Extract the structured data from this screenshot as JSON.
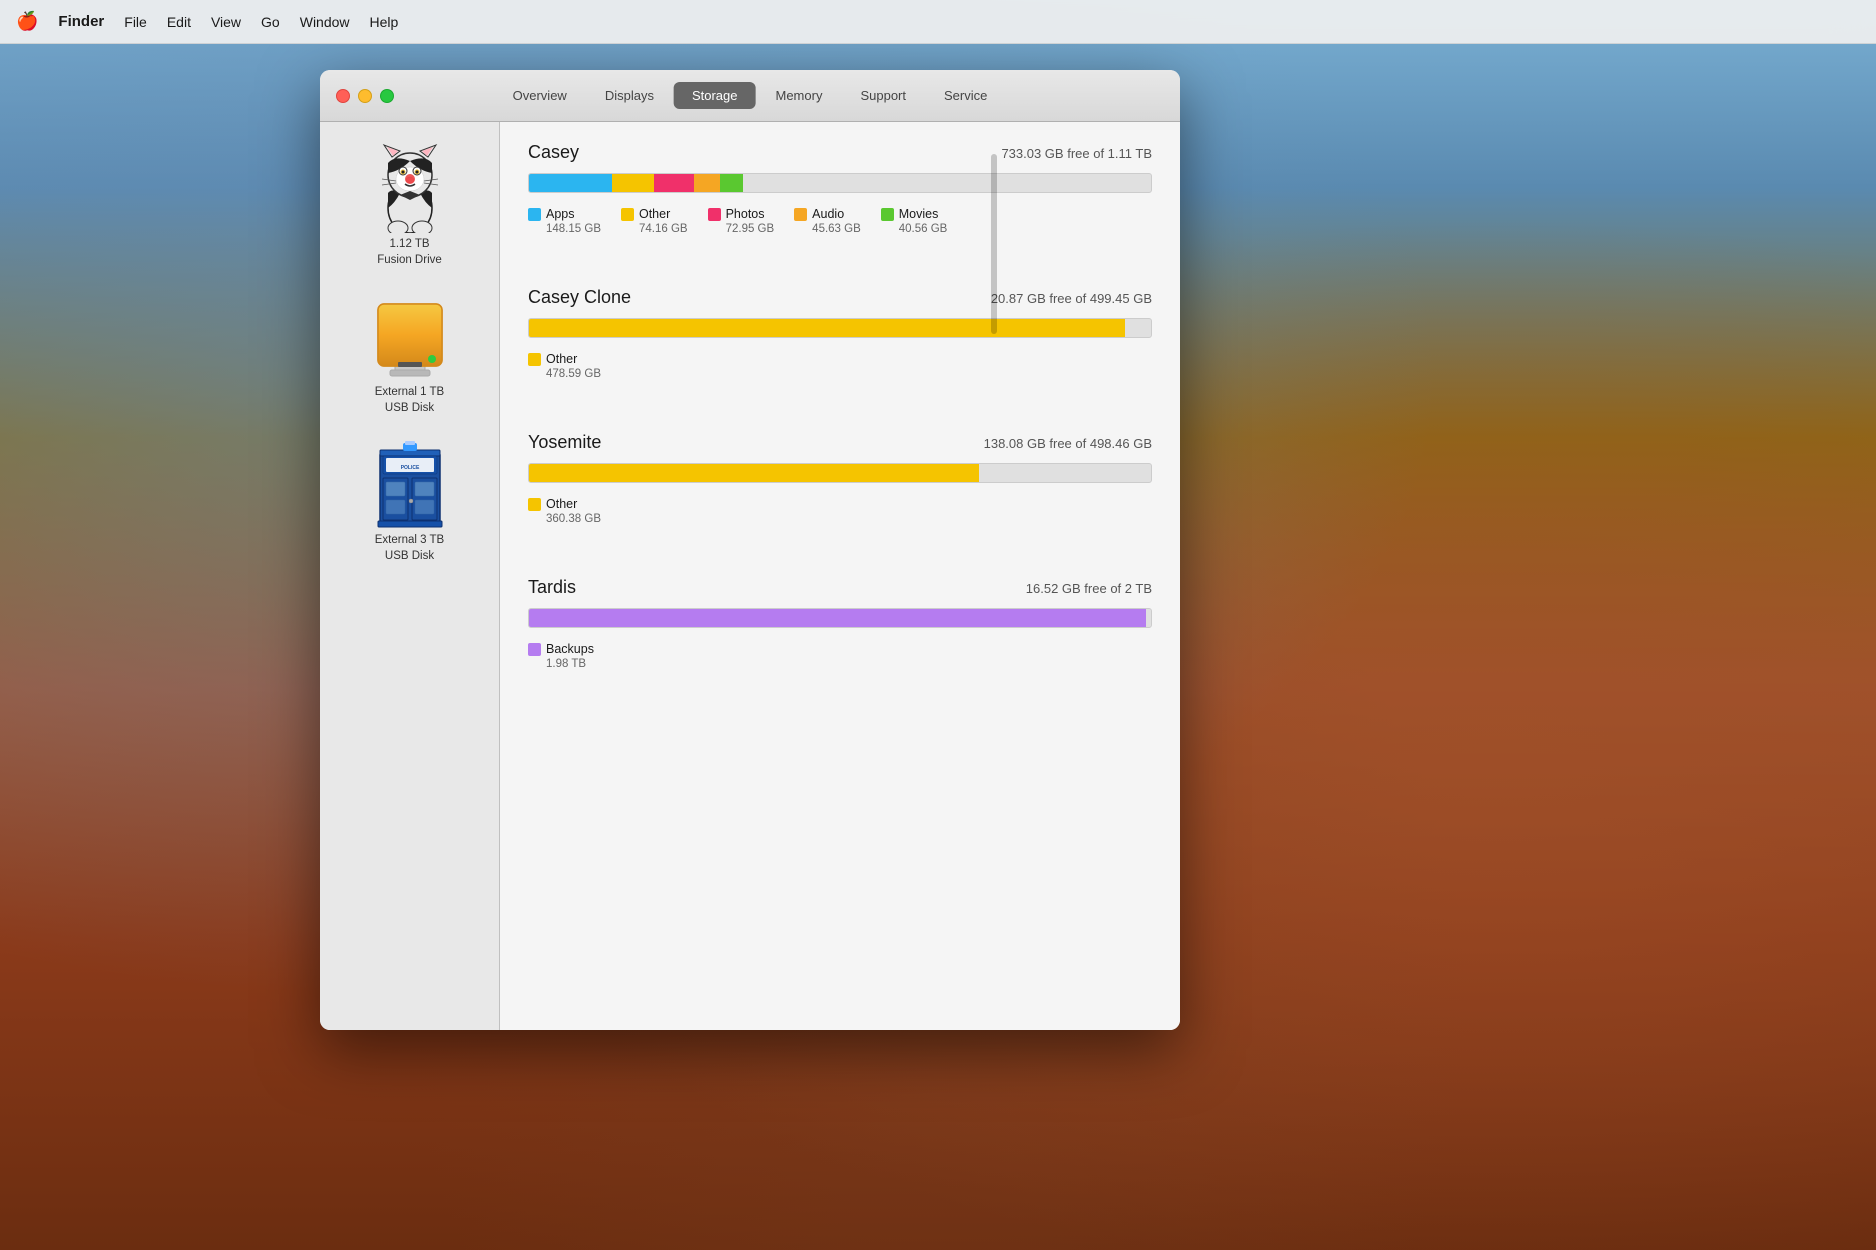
{
  "desktop": {
    "bg_description": "macOS Yosemite El Capitan wallpaper"
  },
  "menu_bar": {
    "apple": "🍎",
    "app_name": "Finder",
    "items": [
      "File",
      "Edit",
      "View",
      "Go",
      "Window",
      "Help"
    ]
  },
  "window": {
    "tabs": [
      {
        "label": "Overview",
        "active": false
      },
      {
        "label": "Displays",
        "active": false
      },
      {
        "label": "Storage",
        "active": true
      },
      {
        "label": "Memory",
        "active": false
      },
      {
        "label": "Support",
        "active": false
      },
      {
        "label": "Service",
        "active": false
      }
    ]
  },
  "sidebar": {
    "items": [
      {
        "name": "casey-drive",
        "icon_type": "sylvester",
        "label_line1": "1.12 TB",
        "label_line2": "Fusion Drive"
      },
      {
        "name": "casey-clone-drive",
        "icon_type": "hdd",
        "label_line1": "External 1 TB",
        "label_line2": "USB Disk"
      },
      {
        "name": "tardis-drive",
        "icon_type": "tardis",
        "label_line1": "External 3 TB",
        "label_line2": "USB Disk"
      }
    ]
  },
  "storage_sections": [
    {
      "id": "casey",
      "title": "Casey",
      "free_text": "733.03 GB free of 1.11 TB",
      "total_gb": 1110,
      "segments": [
        {
          "label": "Apps",
          "size_gb": 148.15,
          "color": "#2bb5f0",
          "size_text": "148.15 GB"
        },
        {
          "label": "Other",
          "size_gb": 74.16,
          "color": "#f5c400",
          "size_text": "74.16 GB"
        },
        {
          "label": "Photos",
          "size_gb": 72.95,
          "color": "#f0306a",
          "size_text": "72.95 GB"
        },
        {
          "label": "Audio",
          "size_gb": 45.63,
          "color": "#f5a623",
          "size_text": "45.63 GB"
        },
        {
          "label": "Movies",
          "size_gb": 40.56,
          "color": "#5ac830",
          "size_text": "40.56 GB"
        }
      ]
    },
    {
      "id": "casey-clone",
      "title": "Casey Clone",
      "free_text": "20.87 GB free of 499.45 GB",
      "total_gb": 499.45,
      "segments": [
        {
          "label": "Other",
          "size_gb": 478.59,
          "color": "#f5c400",
          "size_text": "478.59 GB"
        }
      ]
    },
    {
      "id": "yosemite",
      "title": "Yosemite",
      "free_text": "138.08 GB free of 498.46 GB",
      "total_gb": 498.46,
      "segments": [
        {
          "label": "Other",
          "size_gb": 360.38,
          "color": "#f5c400",
          "size_text": "360.38 GB"
        }
      ]
    },
    {
      "id": "tardis",
      "title": "Tardis",
      "free_text": "16.52 GB free of 2 TB",
      "total_gb": 2000,
      "segments": [
        {
          "label": "Backups",
          "size_gb": 1983.48,
          "color": "#b57cf0",
          "size_text": "1.98 TB"
        }
      ]
    }
  ]
}
